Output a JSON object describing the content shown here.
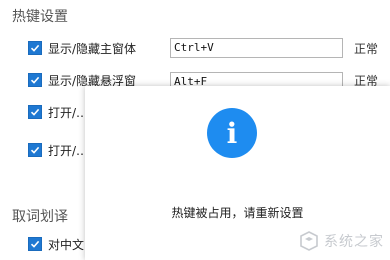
{
  "hotkey_section": {
    "title": "热键设置",
    "rows": [
      {
        "label": "显示/隐藏主窗体",
        "value": "Ctrl+V",
        "status": "正常"
      },
      {
        "label": "显示/隐藏悬浮窗",
        "value": "Alt+F",
        "status": "正常"
      },
      {
        "label": "打开/…"
      },
      {
        "label": "打开/…"
      }
    ]
  },
  "word_section": {
    "title": "取词划译",
    "rows": [
      {
        "label": "对中文"
      }
    ]
  },
  "dialog": {
    "icon": "info-icon",
    "message": "热键被占用，请重新设置"
  },
  "watermark": {
    "text": "系统之家"
  },
  "colors": {
    "accent": "#1e78d2",
    "info_icon": "#1e8cf0"
  }
}
